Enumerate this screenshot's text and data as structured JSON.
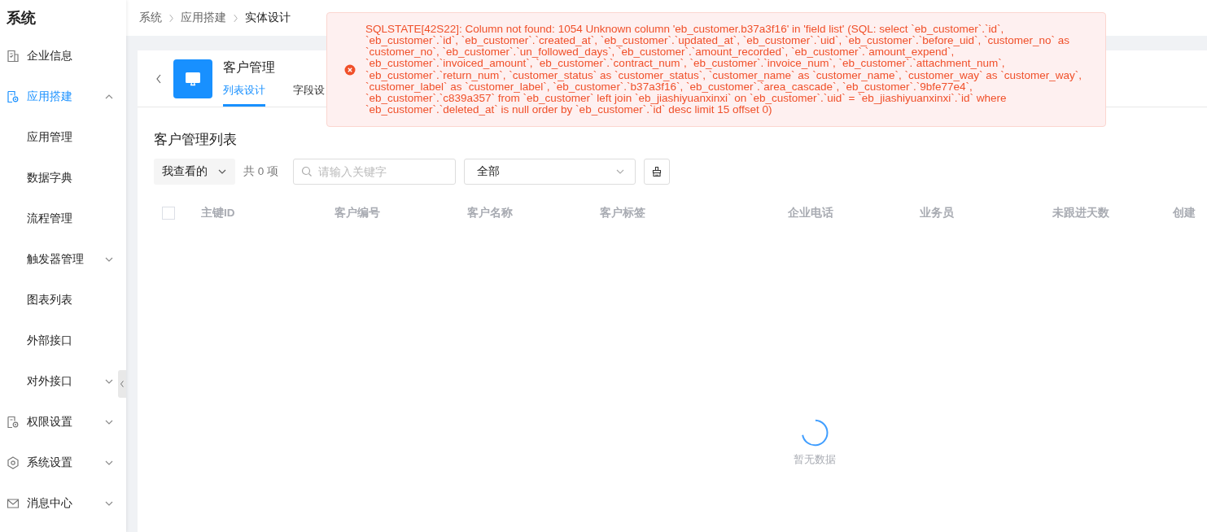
{
  "sidebar": {
    "title": "系统",
    "items": [
      {
        "label": "企业信息",
        "selected": false
      },
      {
        "label": "应用搭建",
        "selected": true,
        "expanded": true,
        "children": [
          {
            "label": "应用管理",
            "selected": false
          },
          {
            "label": "数据字典",
            "selected": false
          },
          {
            "label": "流程管理",
            "selected": false
          },
          {
            "label": "触发器管理",
            "selected": false,
            "expanded": false
          },
          {
            "label": "图表列表",
            "selected": false
          },
          {
            "label": "外部接口",
            "selected": false
          },
          {
            "label": "对外接口",
            "selected": false,
            "expanded": false
          }
        ]
      },
      {
        "label": "权限设置",
        "selected": false,
        "expanded": false
      },
      {
        "label": "系统设置",
        "selected": false,
        "expanded": false
      },
      {
        "label": "消息中心",
        "selected": false,
        "expanded": false
      }
    ]
  },
  "breadcrumb": [
    "系统",
    "应用搭建",
    "实体设计"
  ],
  "entity": {
    "title": "客户管理",
    "tabs": [
      {
        "label": "列表设计",
        "selected": true
      },
      {
        "label": "字段设",
        "selected": false
      }
    ]
  },
  "list": {
    "title": "客户管理列表",
    "filter": "我查看的",
    "count": "共 0 项",
    "search": {
      "placeholder": "请输入关键字"
    },
    "select": "全部"
  },
  "table": {
    "header_checked": false,
    "columns": [
      "主键ID",
      "客户编号",
      "客户名称",
      "客户标签",
      "企业电话",
      "业务员",
      "未跟进天数",
      "创建"
    ],
    "empty_text": "暂无数据"
  },
  "error": {
    "message": "SQLSTATE[42S22]: Column not found: 1054 Unknown column 'eb_customer.b37a3f16' in 'field list' (SQL: select `eb_customer`.`id`, `eb_customer`.`id`, `eb_customer`.`created_at`, `eb_customer`.`updated_at`, `eb_customer`.`uid`, `eb_customer`.`before_uid`, `customer_no` as `customer_no`, `eb_customer`.`un_followed_days`, `eb_customer`.`amount_recorded`, `eb_customer`.`amount_expend`, `eb_customer`.`invoiced_amount`, `eb_customer`.`contract_num`, `eb_customer`.`invoice_num`, `eb_customer`.`attachment_num`, `eb_customer`.`return_num`, `customer_status` as `customer_status`, `customer_name` as `customer_name`, `customer_way` as `customer_way`, `customer_label` as `customer_label`, `eb_customer`.`b37a3f16`, `eb_customer`.`area_cascade`, `eb_customer`.`9bfe77e4`, `eb_customer`.`c839a357` from `eb_customer` left join `eb_jiashiyuanxinxi` on `eb_customer`.`uid` = `eb_jiashiyuanxinxi`.`id` where `eb_customer`.`deleted_at` is null order by `eb_customer`.`id` desc limit 15 offset 0)"
  }
}
